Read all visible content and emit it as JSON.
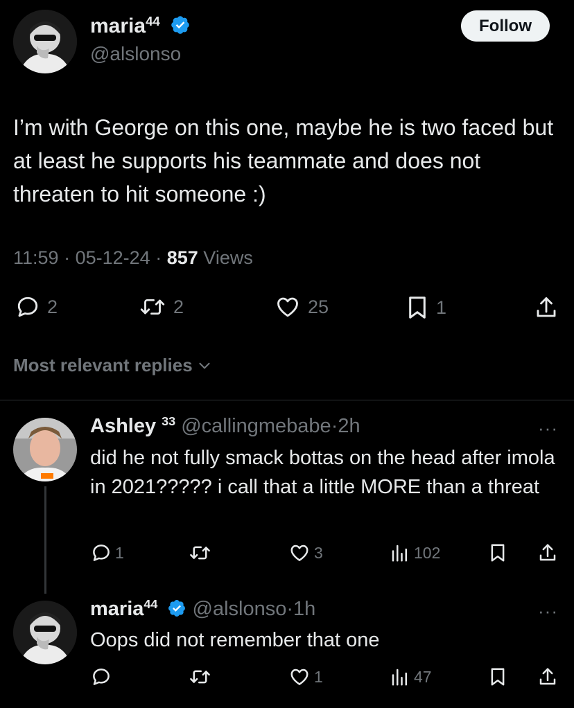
{
  "tweet": {
    "author_name": "maria",
    "author_badge": "44",
    "handle": "@alslonso",
    "follow_label": "Follow",
    "text": "I’m with George on this one, maybe he is two faced but at least he supports his teammate and does not threaten to hit someone :)",
    "time": "11:59",
    "date": "05-12-24",
    "views_count": "857",
    "views_label": "Views",
    "sep": "·",
    "replies": "2",
    "reposts": "2",
    "likes": "25",
    "bookmarks": "1"
  },
  "sort": {
    "label": "Most relevant replies"
  },
  "replies": [
    {
      "author_name": "Ashley",
      "author_badge": "33",
      "handle": "@callingmebabe",
      "sep": "·",
      "age": "2h",
      "text": "did he not fully smack bottas on the head after imola in 2021????? i call that a little MORE than a threat",
      "replies": "1",
      "reposts": "",
      "likes": "3",
      "views": "102",
      "more": "···"
    },
    {
      "author_name": "maria",
      "author_badge": "44",
      "handle": "@alslonso",
      "sep": "·",
      "age": "1h",
      "text": "Oops did not remember that one",
      "replies": "",
      "reposts": "",
      "likes": "1",
      "views": "47",
      "more": "···"
    }
  ],
  "colors": {
    "background": "#000000",
    "text_primary": "#e7e9ea",
    "text_secondary": "#71767b",
    "verified": "#1d9bf0",
    "divider": "#2f3336"
  },
  "icons": [
    "reply-icon",
    "repost-icon",
    "like-icon",
    "bookmark-icon",
    "share-icon",
    "views-icon",
    "verified-icon",
    "chevron-down-icon",
    "more-icon"
  ]
}
